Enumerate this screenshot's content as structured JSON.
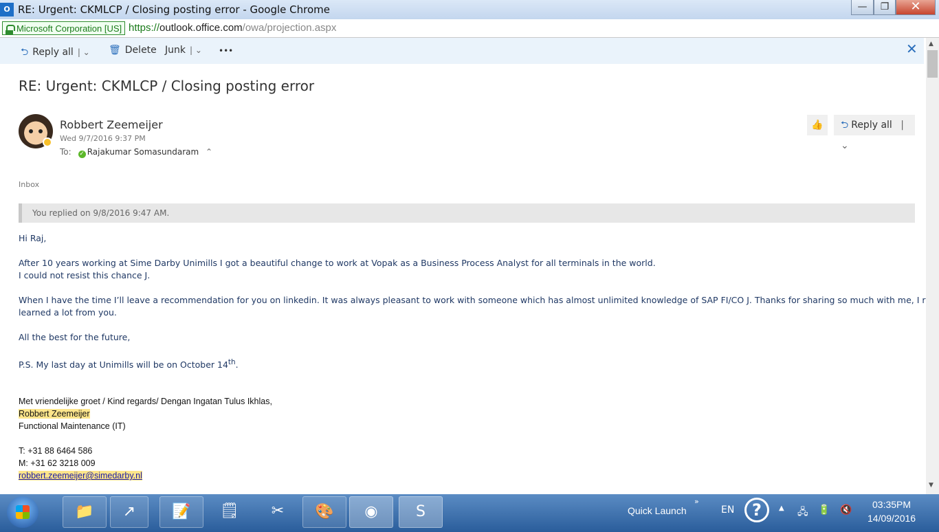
{
  "window": {
    "title": "RE: Urgent: CKMLCP / Closing posting error - Google Chrome",
    "app_icon": "outlook-icon",
    "minimize": "—",
    "maximize": "❐",
    "close": "✕"
  },
  "address": {
    "ev_label": "Microsoft Corporation [US]",
    "scheme": "https://",
    "host": "outlook.office.com",
    "path": "/owa/projection.aspx"
  },
  "toolbar": {
    "reply_all": "Reply all",
    "delete": "Delete",
    "junk": "Junk",
    "more": "•••",
    "close": "✕"
  },
  "message": {
    "subject": "RE: Urgent: CKMLCP / Closing posting error",
    "sender": "Robbert Zeemeijer",
    "date": "Wed 9/7/2016 9:37 PM",
    "to_label": "To:",
    "recipient": "Rajakumar Somasundaram",
    "reply_all": "Reply all",
    "folder": "Inbox",
    "replied_notice": "You replied on 9/8/2016 9:47 AM."
  },
  "body": {
    "greeting": "Hi Raj,",
    "p1_line1": "After 10 years working at Sime Darby Unimills I got a beautiful change to work at Vopak as a Business Process Analyst for all terminals in the world.",
    "p1_line2": "I could not resist this chance J.",
    "p2_line1": "When I have the time I’ll leave a recommendation for you on linkedin. It was always pleasant to work with someone which has almost unlimited knowledge of SAP FI/CO J. Thanks for sharing so much with me, I really",
    "p2_line2": "learned a lot from you.",
    "p3": "All the best for the future,",
    "ps_text": "P.S. My last day at Unimills will be on October 14",
    "ps_sup": "th",
    "ps_end": "."
  },
  "signature": {
    "closing": "Met vriendelijke groet / Kind regards/ Dengan Ingatan Tulus Ikhlas,",
    "name": "Robbert Zeemeijer",
    "role": "Functional Maintenance (IT)",
    "phone": "T:  +31 88 6464 586",
    "mobile": "M: +31 62 3218 009",
    "email": "robbert.zeemeijer@simedarby.nl"
  },
  "taskbar": {
    "quick_launch": "Quick Launch",
    "language": "EN",
    "time": "03:35PM",
    "date": "14/09/2016"
  }
}
